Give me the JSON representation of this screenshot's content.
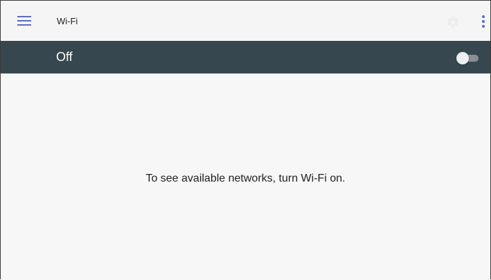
{
  "toolbar": {
    "menu_icon": "menu-icon",
    "title": "Wi-Fi",
    "gear_icon": "gear-icon",
    "overflow_icon": "more-vert-icon",
    "accent_color": "#5c6bc0"
  },
  "switch_bar": {
    "label": "Off",
    "toggle_state": "off",
    "background_color": "#37474f"
  },
  "content": {
    "message": "To see available networks, turn Wi-Fi on."
  }
}
